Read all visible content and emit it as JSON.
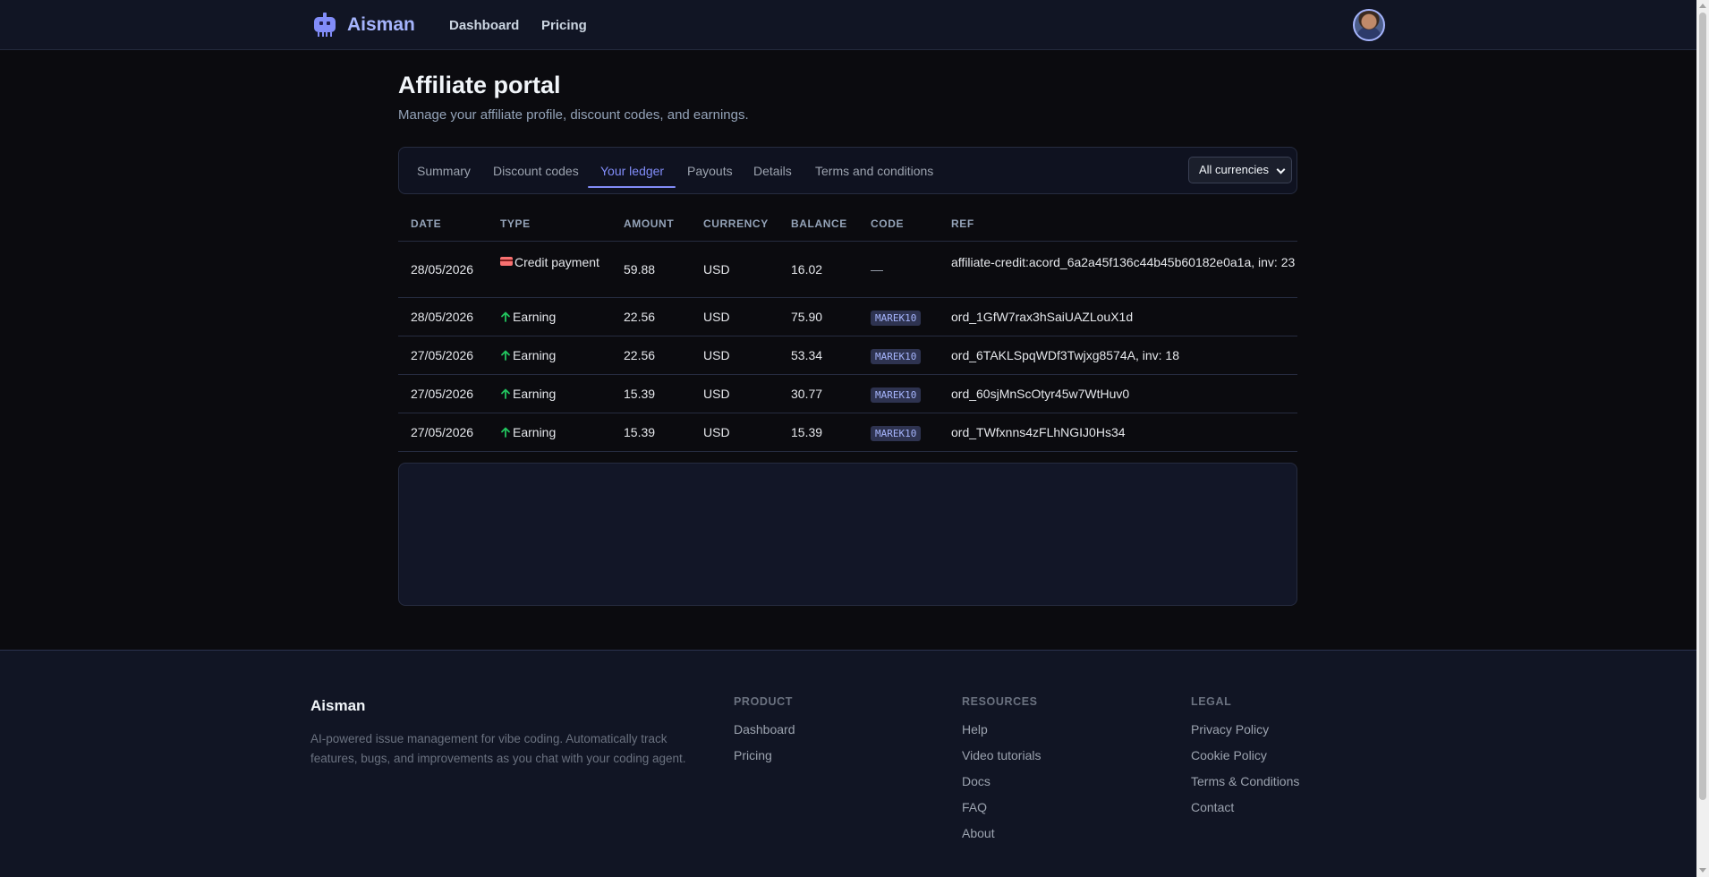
{
  "nav": {
    "brand": "Aisman",
    "links": [
      "Dashboard",
      "Pricing"
    ]
  },
  "header": {
    "title": "Affiliate portal",
    "subtitle": "Manage your affiliate profile, discount codes, and earnings."
  },
  "tabs": {
    "items": [
      "Summary",
      "Discount codes",
      "Your ledger",
      "Payouts",
      "Details",
      "Terms and conditions"
    ],
    "active": "Your ledger",
    "currency_select": "All currencies"
  },
  "ledger": {
    "columns": [
      "DATE",
      "TYPE",
      "AMOUNT",
      "CURRENCY",
      "BALANCE",
      "CODE",
      "REF"
    ],
    "rows": [
      {
        "date": "28/05/2026",
        "type": "Credit payment",
        "type_icon": "credit-card-icon",
        "amount": "59.88",
        "currency": "USD",
        "balance": "16.02",
        "code": "—",
        "ref": "affiliate-credit:acord_6a2a45f136c44b45b60182e0a1a, inv: 23"
      },
      {
        "date": "28/05/2026",
        "type": "Earning",
        "type_icon": "arrow-up-icon",
        "amount": "22.56",
        "currency": "USD",
        "balance": "75.90",
        "code": "MAREK10",
        "ref": "ord_1GfW7rax3hSaiUAZLouX1d"
      },
      {
        "date": "27/05/2026",
        "type": "Earning",
        "type_icon": "arrow-up-icon",
        "amount": "22.56",
        "currency": "USD",
        "balance": "53.34",
        "code": "MAREK10",
        "ref": "ord_6TAKLSpqWDf3Twjxg8574A, inv: 18"
      },
      {
        "date": "27/05/2026",
        "type": "Earning",
        "type_icon": "arrow-up-icon",
        "amount": "15.39",
        "currency": "USD",
        "balance": "30.77",
        "code": "MAREK10",
        "ref": "ord_60sjMnScOtyr45w7WtHuv0"
      },
      {
        "date": "27/05/2026",
        "type": "Earning",
        "type_icon": "arrow-up-icon",
        "amount": "15.39",
        "currency": "USD",
        "balance": "15.39",
        "code": "MAREK10",
        "ref": "ord_TWfxnns4zFLhNGIJ0Hs34"
      }
    ]
  },
  "footer": {
    "brand": "Aisman",
    "description": "AI-powered issue management for vibe coding. Automatically track features, bugs, and improvements as you chat with your coding agent.",
    "product": {
      "heading": "PRODUCT",
      "links": [
        "Dashboard",
        "Pricing"
      ]
    },
    "resources": {
      "heading": "RESOURCES",
      "links": [
        "Help",
        "Video tutorials",
        "Docs",
        "FAQ",
        "About"
      ]
    },
    "legal": {
      "heading": "LEGAL",
      "links": [
        "Privacy Policy",
        "Cookie Policy",
        "Terms & Conditions",
        "Contact"
      ]
    }
  },
  "colors": {
    "accent": "#818cf8",
    "earning_icon": "#22c55e",
    "credit_icon": "#f87171",
    "background": "#0b0b0f",
    "nav_background": "#111524"
  }
}
